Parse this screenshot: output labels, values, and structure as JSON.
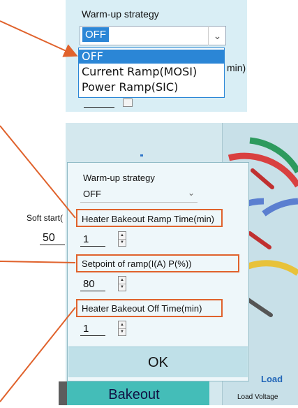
{
  "top_zoom": {
    "label": "Warm-up strategy",
    "selected": "OFF",
    "options": [
      "OFF",
      "Current Ramp(MOSI)",
      "Power Ramp(SIC)"
    ],
    "peek_text": "min)"
  },
  "dialog": {
    "warmup_label": "Warm-up strategy",
    "warmup_value": "OFF",
    "ramp_time_label": "Heater Bakeout Ramp Time(min)",
    "ramp_time_value": "1",
    "setpoint_label": "Setpoint of ramp(I(A) P(%))",
    "setpoint_value": "80",
    "off_time_label": "Heater Bakeout Off Time(min)",
    "off_time_value": "1",
    "ok_label": "OK"
  },
  "background": {
    "soft_start_label": "Soft start(",
    "soft_start_value": "50",
    "bakeout_label": "Bakeout",
    "load_title": "Load",
    "load_voltage_label": "Load Voltage"
  },
  "colors": {
    "annotation": "#e0622c",
    "selection": "#2b86d6",
    "bakeout_button": "#44bdb8",
    "gauge_red": "#d94040",
    "gauge_blue": "#5b7fd0",
    "gauge_yellow": "#e8c23a",
    "gauge_green": "#2e9a5e",
    "gauge_gray": "#555555"
  }
}
